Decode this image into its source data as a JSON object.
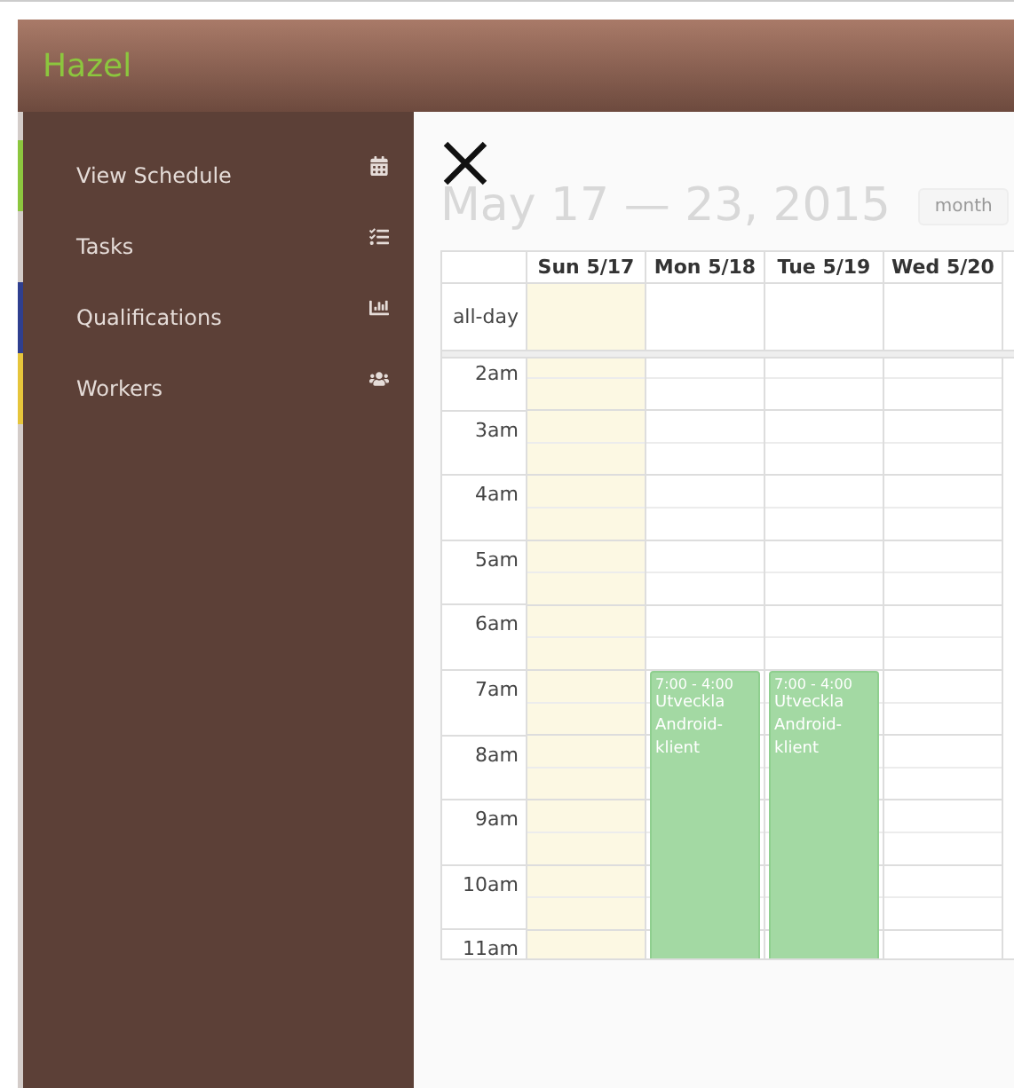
{
  "header": {
    "brand": "Hazel"
  },
  "sidebar": {
    "items": [
      {
        "label": "View Schedule",
        "color": "#8cc63e"
      },
      {
        "label": "Tasks",
        "color": "#d3ccc9"
      },
      {
        "label": "Qualifications",
        "color": "#2f3f8f"
      },
      {
        "label": "Workers",
        "color": "#e6c53b"
      }
    ]
  },
  "calendar": {
    "title": "May 17 — 23, 2015",
    "view_buttons": [
      "month"
    ],
    "allday_label": "all-day",
    "days": [
      {
        "label": "Sun 5/17",
        "today": true
      },
      {
        "label": "Mon 5/18",
        "today": false,
        "events": [
          {
            "time": "7:00 - 4:00",
            "title": "Utveckla Android-klient"
          }
        ]
      },
      {
        "label": "Tue 5/19",
        "today": false,
        "events": [
          {
            "time": "7:00 - 4:00",
            "title": "Utveckla Android-klient"
          }
        ]
      },
      {
        "label": "Wed 5/20",
        "today": false
      }
    ],
    "hours": [
      "2am",
      "3am",
      "4am",
      "5am",
      "6am",
      "7am",
      "8am",
      "9am",
      "10am",
      "11am"
    ]
  }
}
